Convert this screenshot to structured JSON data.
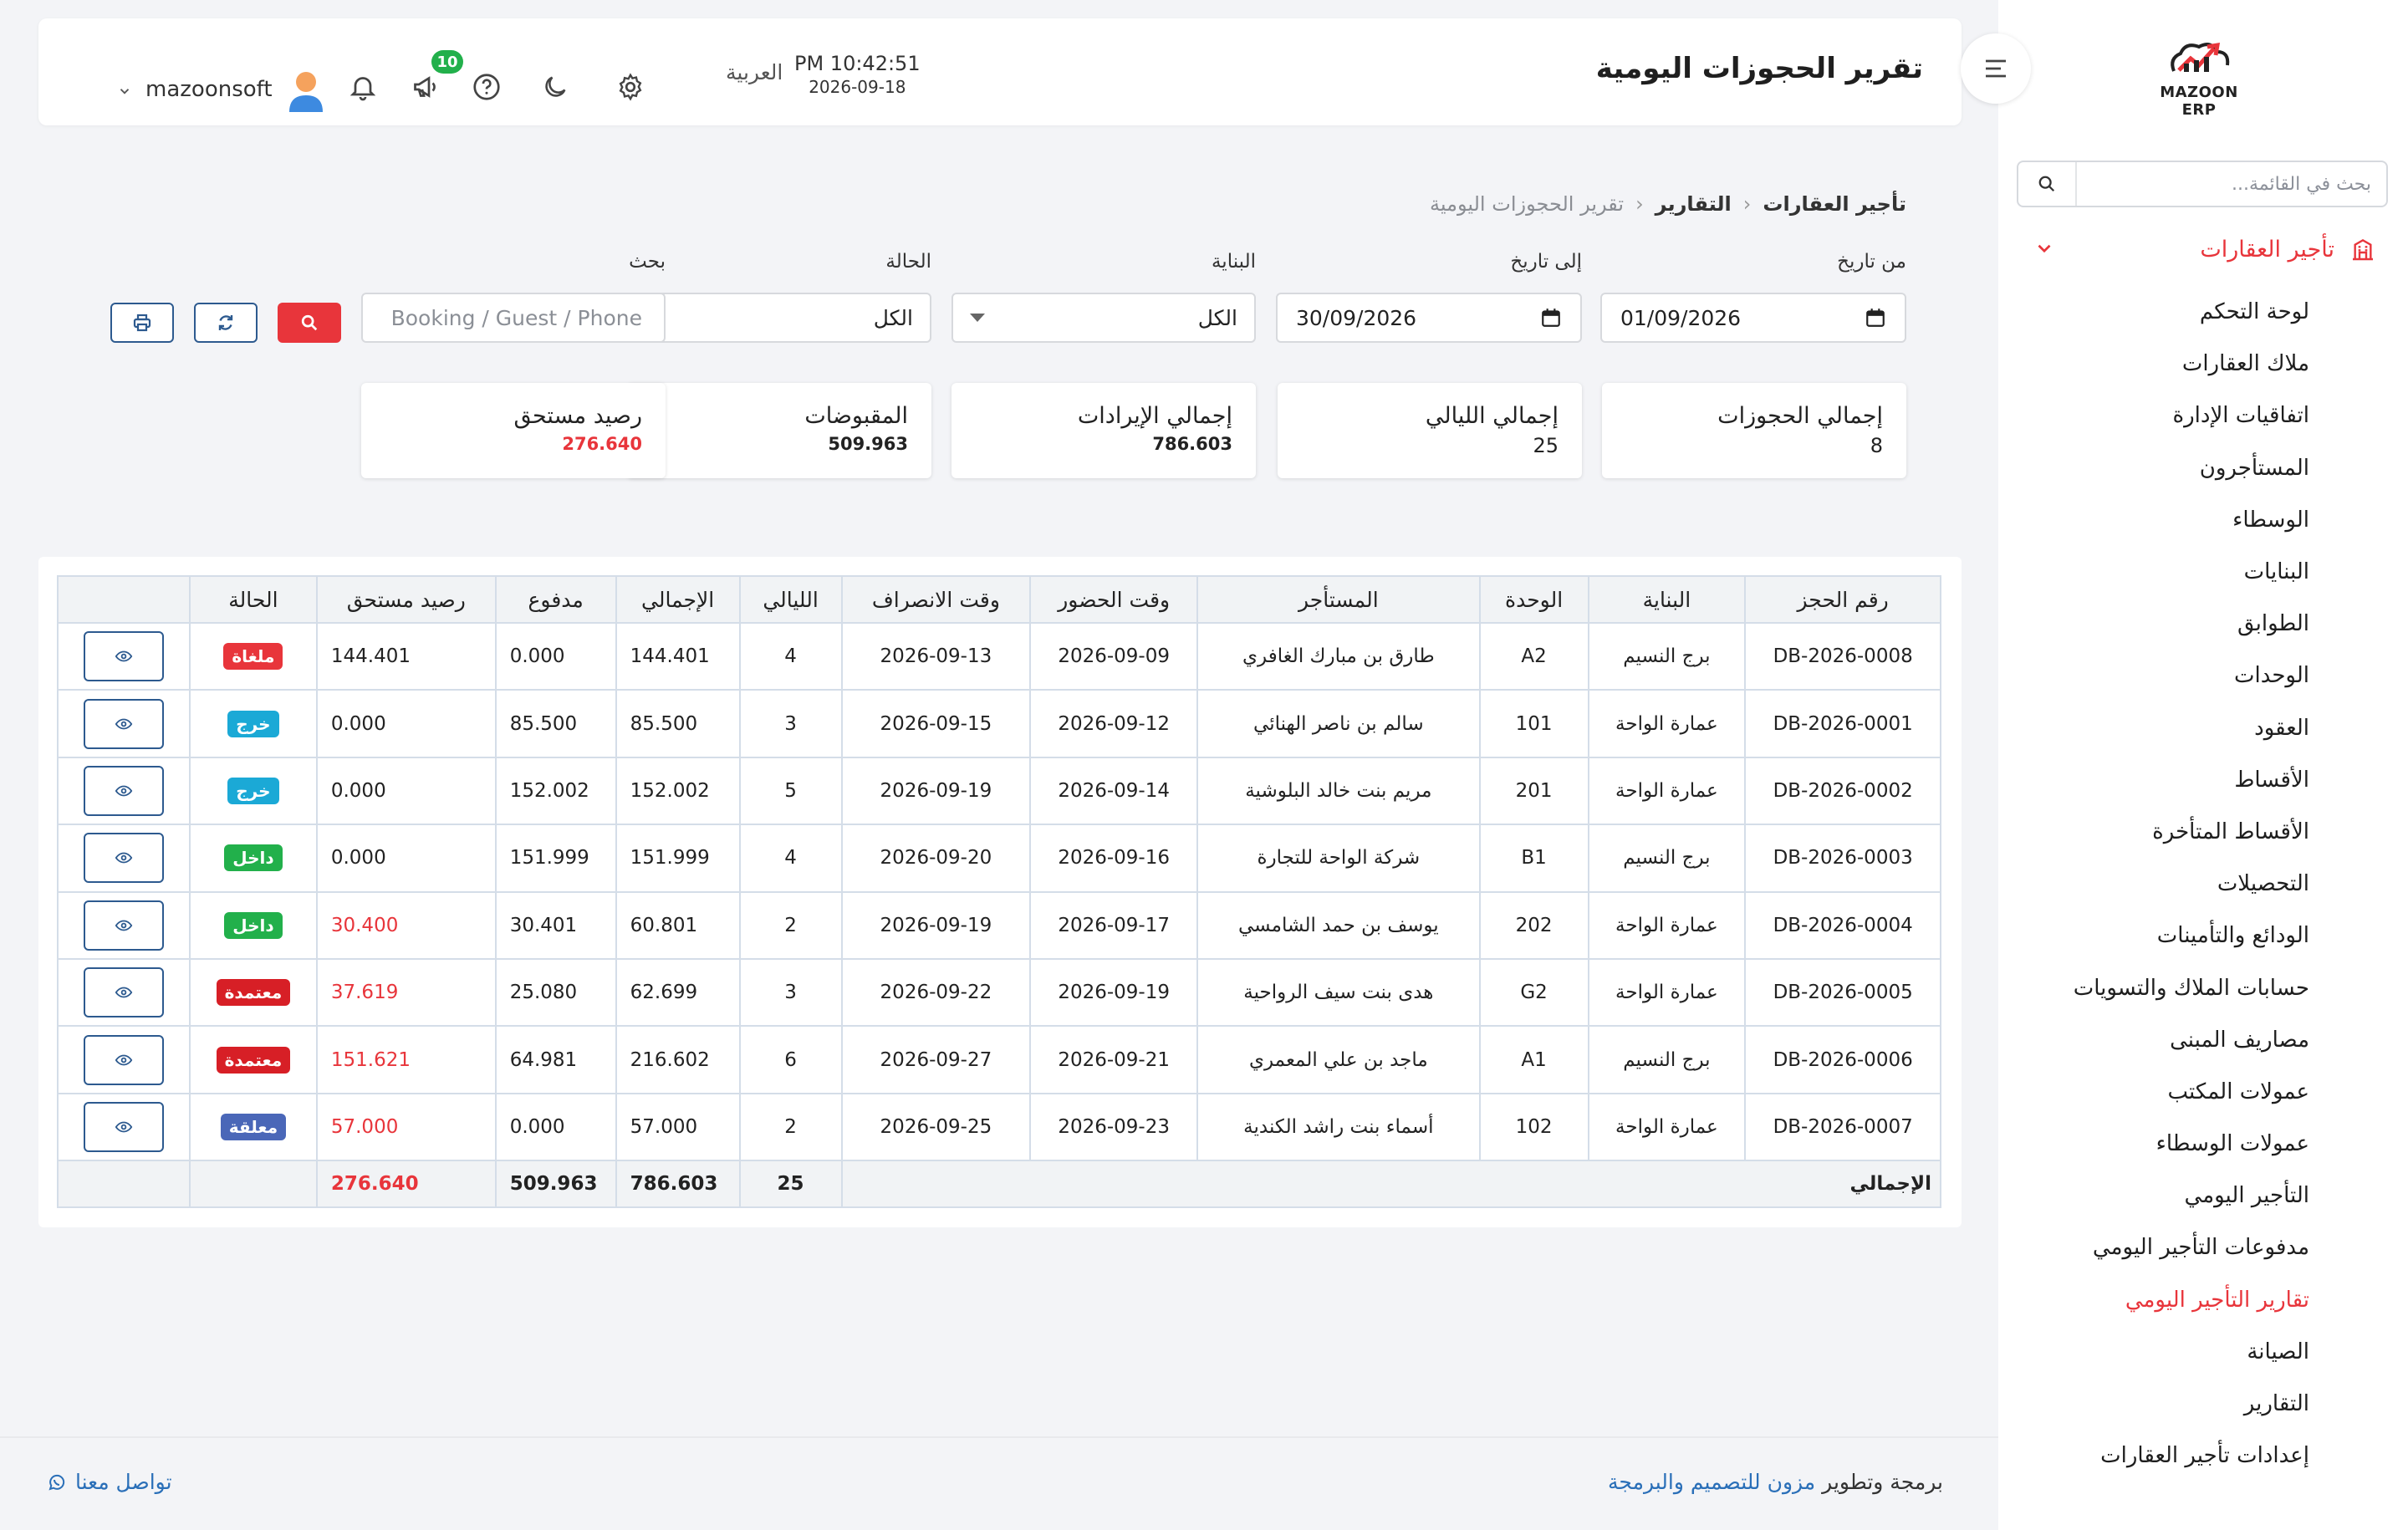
{
  "app": {
    "logo_text": "MAZOON ERP",
    "logo_sub": "ERP|ERP"
  },
  "sidebar": {
    "search_placeholder": "بحث في القائمة...",
    "group_label": "تأجير العقارات",
    "items": [
      {
        "label": "لوحة التحكم"
      },
      {
        "label": "ملاك العقارات"
      },
      {
        "label": "اتفاقيات الإدارة"
      },
      {
        "label": "المستأجرون"
      },
      {
        "label": "الوسطاء"
      },
      {
        "label": "البنايات"
      },
      {
        "label": "الطوابق"
      },
      {
        "label": "الوحدات"
      },
      {
        "label": "العقود"
      },
      {
        "label": "الأقساط"
      },
      {
        "label": "الأقساط المتأخرة"
      },
      {
        "label": "التحصيلات"
      },
      {
        "label": "الودائع والتأمينات"
      },
      {
        "label": "حسابات الملاك والتسويات"
      },
      {
        "label": "مصاريف المبنى"
      },
      {
        "label": "عمولات المكتب"
      },
      {
        "label": "عمولات الوسطاء"
      },
      {
        "label": "التأجير اليومي"
      },
      {
        "label": "مدفوعات التأجير اليومي"
      },
      {
        "label": "تقارير التأجير اليومي",
        "active": true
      },
      {
        "label": "الصيانة"
      },
      {
        "label": "التقارير"
      },
      {
        "label": "إعدادات تأجير العقارات"
      }
    ]
  },
  "header": {
    "title": "تقرير الحجوزات اليومية",
    "time": "PM 10:42:51",
    "date": "2026-09-18",
    "language": "العربية",
    "notifications_count": "10",
    "username": "mazoonsoft"
  },
  "breadcrumb": {
    "level1": "تأجير العقارات",
    "level2": "التقارير",
    "level3": "تقرير الحجوزات اليومية",
    "separator": "‹"
  },
  "filters": {
    "from_label": "من تاريخ",
    "from_value": "01/09/2026",
    "to_label": "إلى تاريخ",
    "to_value": "30/09/2026",
    "building_label": "البناية",
    "building_value": "الكل",
    "status_label": "الحالة",
    "status_value": "الكل",
    "search_label": "بحث",
    "search_placeholder": "Booking / Guest / Phone"
  },
  "summary": {
    "bookings_label": "إجمالي الحجوزات",
    "bookings_value": "8",
    "nights_label": "إجمالي الليالي",
    "nights_value": "25",
    "revenue_label": "إجمالي الإيرادات",
    "revenue_value": "786.603",
    "received_label": "المقبوضات",
    "received_value": "509.963",
    "due_label": "رصيد مستحق",
    "due_value": "276.640"
  },
  "table": {
    "headers": [
      "رقم الحجز",
      "البناية",
      "الوحدة",
      "المستأجر",
      "وقت الحضور",
      "وقت الانصراف",
      "الليالي",
      "الإجمالي",
      "مدفوع",
      "رصيد مستحق",
      "الحالة",
      ""
    ],
    "rows": [
      {
        "id": "DB-2026-0008",
        "building": "برج النسيم",
        "unit": "A2",
        "tenant": "طارق بن مبارك الغافري",
        "checkin": "2026-09-09",
        "checkout": "2026-09-13",
        "nights": "4",
        "total": "144.401",
        "paid": "0.000",
        "due": "144.401",
        "due_red": false,
        "status": "ملغاة",
        "status_color": "#e8353b"
      },
      {
        "id": "DB-2026-0001",
        "building": "عمارة الواحة",
        "unit": "101",
        "tenant": "سالم بن ناصر الهنائي",
        "checkin": "2026-09-12",
        "checkout": "2026-09-15",
        "nights": "3",
        "total": "85.500",
        "paid": "85.500",
        "due": "0.000",
        "due_red": false,
        "status": "خرج",
        "status_color": "#1ba9d6"
      },
      {
        "id": "DB-2026-0002",
        "building": "عمارة الواحة",
        "unit": "201",
        "tenant": "مريم بنت خالد البلوشية",
        "checkin": "2026-09-14",
        "checkout": "2026-09-19",
        "nights": "5",
        "total": "152.002",
        "paid": "152.002",
        "due": "0.000",
        "due_red": false,
        "status": "خرج",
        "status_color": "#1ba9d6"
      },
      {
        "id": "DB-2026-0003",
        "building": "برج النسيم",
        "unit": "B1",
        "tenant": "شركة الواحة للتجارة",
        "checkin": "2026-09-16",
        "checkout": "2026-09-20",
        "nights": "4",
        "total": "151.999",
        "paid": "151.999",
        "due": "0.000",
        "due_red": false,
        "status": "داخل",
        "status_color": "#22b04b"
      },
      {
        "id": "DB-2026-0004",
        "building": "عمارة الواحة",
        "unit": "202",
        "tenant": "يوسف بن حمد الشامسي",
        "checkin": "2026-09-17",
        "checkout": "2026-09-19",
        "nights": "2",
        "total": "60.801",
        "paid": "30.401",
        "due": "30.400",
        "due_red": true,
        "status": "داخل",
        "status_color": "#22b04b"
      },
      {
        "id": "DB-2026-0005",
        "building": "عمارة الواحة",
        "unit": "G2",
        "tenant": "هدى بنت سيف الرواحية",
        "checkin": "2026-09-19",
        "checkout": "2026-09-22",
        "nights": "3",
        "total": "62.699",
        "paid": "25.080",
        "due": "37.619",
        "due_red": true,
        "status": "معتمدة",
        "status_color": "#d71f26"
      },
      {
        "id": "DB-2026-0006",
        "building": "برج النسيم",
        "unit": "A1",
        "tenant": "ماجد بن علي المعمري",
        "checkin": "2026-09-21",
        "checkout": "2026-09-27",
        "nights": "6",
        "total": "216.602",
        "paid": "64.981",
        "due": "151.621",
        "due_red": true,
        "status": "معتمدة",
        "status_color": "#d71f26"
      },
      {
        "id": "DB-2026-0007",
        "building": "عمارة الواحة",
        "unit": "102",
        "tenant": "أسماء بنت راشد الكندية",
        "checkin": "2026-09-23",
        "checkout": "2026-09-25",
        "nights": "2",
        "total": "57.000",
        "paid": "0.000",
        "due": "57.000",
        "due_red": true,
        "status": "معلقة",
        "status_color": "#4a67b8"
      }
    ],
    "footer": {
      "label": "الإجمالي",
      "nights": "25",
      "total": "786.603",
      "paid": "509.963",
      "due": "276.640"
    }
  },
  "footer": {
    "credit_prefix": "برمجة وتطوير",
    "credit_link": "مزون للتصميم والبرمجة",
    "contact": "تواصل معنا"
  },
  "colors": {
    "accent": "#e8353b",
    "link": "#2a6fb8",
    "button_blue": "#2d5a8f",
    "badge_green": "#22b04b"
  },
  "icons": [
    "search-icon",
    "building-icon",
    "chevron-down-icon",
    "menu-toggle-icon",
    "gear-icon",
    "moon-icon",
    "help-icon",
    "megaphone-icon",
    "bell-icon",
    "user-avatar-icon",
    "calendar-icon",
    "print-icon",
    "refresh-icon",
    "eye-icon",
    "whatsapp-icon"
  ]
}
